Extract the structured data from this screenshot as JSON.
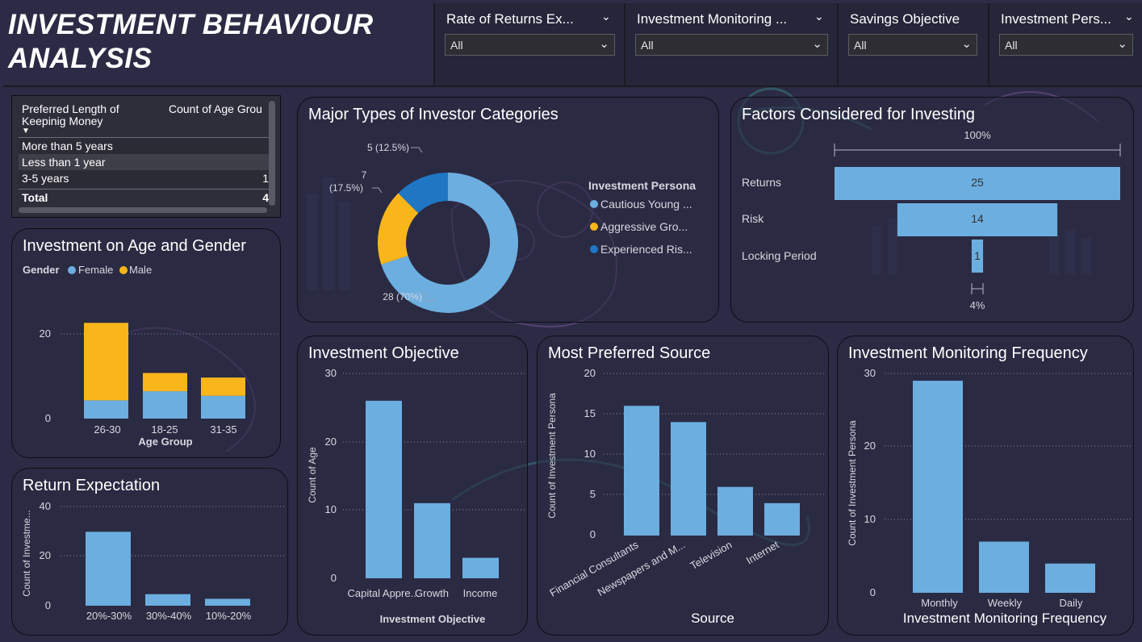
{
  "header": {
    "title": "INVESTMENT BEHAVIOUR ANALYSIS"
  },
  "slicers": [
    {
      "title": "Rate of Returns Ex...",
      "value": "All"
    },
    {
      "title": "Investment Monitoring ...",
      "value": "All"
    },
    {
      "title": "Savings Objective",
      "value": "All"
    },
    {
      "title": "Investment Pers...",
      "value": "All"
    }
  ],
  "table": {
    "col1": "Preferred Length of Keepinig Money",
    "col2": "Count of Age Grou",
    "sort_icon": "sort-descending-icon",
    "rows": [
      {
        "label": "More than 5 years",
        "value": ""
      },
      {
        "label": "Less than 1 year",
        "value": ""
      },
      {
        "label": "3-5 years",
        "value": "1"
      }
    ],
    "total_label": "Total",
    "total_value": "4"
  },
  "donut": {
    "title": "Major Types of Investor Categories",
    "legend_title": "Investment Persona",
    "legend": [
      "Cautious Young ...",
      "Aggressive Gro...",
      "Experienced Ris..."
    ],
    "labels": [
      "28 (70%)",
      "7",
      "(17.5%)",
      "5 (12.5%)"
    ]
  },
  "funnel": {
    "title": "Factors Considered for Investing",
    "top_pct": "100%",
    "bottom_pct": "4%",
    "categories": [
      "Returns",
      "Risk",
      "Locking Period"
    ],
    "value_labels": [
      "25",
      "14",
      "1"
    ]
  },
  "age_gender": {
    "title": "Investment on Age and Gender",
    "legend_title": "Gender",
    "legend": [
      "Female",
      "Male"
    ],
    "ticks": [
      "20",
      "0"
    ],
    "categories": [
      "26-30",
      "18-25",
      "31-35"
    ],
    "xlabel": "Age Group"
  },
  "return_exp": {
    "title": "Return Expectation",
    "ylabel": "Count of Investme...",
    "ticks": [
      "40",
      "20",
      "0"
    ],
    "categories": [
      "20%-30%",
      "30%-40%",
      "10%-20%"
    ]
  },
  "objective": {
    "title": "Investment Objective",
    "ylabel": "Count of Age",
    "ticks": [
      "30",
      "20",
      "10",
      "0"
    ],
    "categories": [
      "Capital Appre...",
      "Growth",
      "Income"
    ],
    "xlabel": "Investment Objective"
  },
  "source": {
    "title": "Most Preferred Source",
    "ylabel": "Count of Investment Persona",
    "ticks": [
      "20",
      "15",
      "10",
      "5",
      "0"
    ],
    "categories": [
      "Financial Consultants",
      "Newspapers and M...",
      "Television",
      "Internet"
    ],
    "xlabel": "Source"
  },
  "monitoring": {
    "title": "Investment Monitoring Frequency",
    "ylabel": "Count of Investment Persona",
    "ticks": [
      "30",
      "20",
      "10",
      "0"
    ],
    "categories": [
      "Monthly",
      "Weekly",
      "Daily"
    ],
    "xlabel": "Investment Monitoring Frequency"
  },
  "colors": {
    "blue": "#6caee0",
    "yellow": "#f8b61b",
    "darkblue": "#1f77c4",
    "background": "#2b2b45"
  },
  "chart_data": [
    {
      "type": "pie",
      "title": "Major Types of Investor Categories",
      "categories": [
        "Cautious Young ...",
        "Aggressive Gro...",
        "Experienced Ris..."
      ],
      "values": [
        28,
        7,
        5
      ]
    },
    {
      "type": "bar",
      "title": "Factors Considered for Investing",
      "categories": [
        "Returns",
        "Risk",
        "Locking Period"
      ],
      "values": [
        25,
        14,
        1
      ]
    },
    {
      "type": "bar",
      "title": "Investment on Age and Gender",
      "categories": [
        "26-30",
        "18-25",
        "31-35"
      ],
      "series": [
        {
          "name": "Female",
          "values": [
            4,
            6,
            5
          ]
        },
        {
          "name": "Male",
          "values": [
            17,
            4,
            4
          ]
        }
      ],
      "xlabel": "Age Group",
      "ylim": [
        0,
        23
      ]
    },
    {
      "type": "bar",
      "title": "Return Expectation",
      "categories": [
        "20%-30%",
        "30%-40%",
        "10%-20%"
      ],
      "values": [
        32,
        5,
        3
      ],
      "ylabel": "Count of Investme...",
      "ylim": [
        0,
        44
      ]
    },
    {
      "type": "bar",
      "title": "Investment Objective",
      "categories": [
        "Capital Appre...",
        "Growth",
        "Income"
      ],
      "values": [
        26,
        11,
        3
      ],
      "xlabel": "Investment Objective",
      "ylabel": "Count of Age",
      "ylim": [
        0,
        30
      ]
    },
    {
      "type": "bar",
      "title": "Most Preferred Source",
      "categories": [
        "Financial Consultants",
        "Newspapers and M...",
        "Television",
        "Internet"
      ],
      "values": [
        16,
        14,
        6,
        4
      ],
      "xlabel": "Source",
      "ylabel": "Count of Investment Persona",
      "ylim": [
        0,
        20
      ]
    },
    {
      "type": "bar",
      "title": "Investment Monitoring Frequency",
      "categories": [
        "Monthly",
        "Weekly",
        "Daily"
      ],
      "values": [
        29,
        7,
        4
      ],
      "xlabel": "Investment Monitoring Frequency",
      "ylabel": "Count of Investment Persona",
      "ylim": [
        0,
        30
      ]
    }
  ]
}
